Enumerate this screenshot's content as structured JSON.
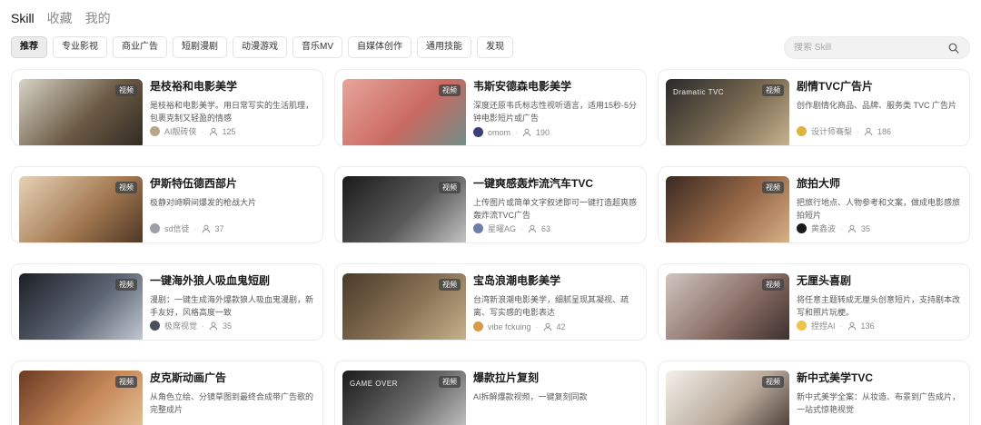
{
  "top_tabs": [
    {
      "label": "Skill",
      "active": true
    },
    {
      "label": "收藏",
      "active": false
    },
    {
      "label": "我的",
      "active": false
    }
  ],
  "filters": [
    {
      "label": "推荐",
      "active": true
    },
    {
      "label": "专业影视"
    },
    {
      "label": "商业广告"
    },
    {
      "label": "短剧漫剧"
    },
    {
      "label": "动漫游戏"
    },
    {
      "label": "音乐MV"
    },
    {
      "label": "自媒体创作"
    },
    {
      "label": "通用技能"
    },
    {
      "label": "发现"
    }
  ],
  "search": {
    "placeholder": "搜索 Skill",
    "icon": "search-icon"
  },
  "cards": [
    {
      "title": "是枝裕和电影美学",
      "desc": "是枝裕和电影美学。用日常写实的生活肌理，包裹克制又轻盈的情感",
      "author": "AI靓砖侠",
      "count": "125",
      "badge": "视频",
      "overlay": "",
      "thumb_colors": [
        "#d8d4c8",
        "#6b5a44",
        "#2f2a22"
      ],
      "avatar_color": "#b9a58a"
    },
    {
      "title": "韦斯安德森电影美学",
      "desc": "深度还原韦氏标志性视听语言，适用15秒-5分钟电影短片或广告",
      "author": "omom",
      "count": "190",
      "badge": "视频",
      "overlay": "",
      "thumb_colors": [
        "#e8a59a",
        "#c96a62",
        "#6d8f8a"
      ],
      "avatar_color": "#3a3f7a"
    },
    {
      "title": "剧情TVC广告片",
      "desc": "创作剧情化商品、品牌、服务类 TVC 广告片",
      "author": "设计师骞梨",
      "count": "186",
      "badge": "视频",
      "overlay": "Dramatic TVC",
      "thumb_colors": [
        "#2a2a2a",
        "#7a6a52",
        "#c9b58f"
      ],
      "avatar_color": "#e0b33a"
    },
    {
      "title": "伊斯特伍德西部片",
      "desc": "极静对峙瞬间爆发的枪战大片",
      "author": "sd信徒",
      "count": "37",
      "badge": "视频",
      "overlay": "",
      "thumb_colors": [
        "#e6d3b8",
        "#a47a52",
        "#4a3422"
      ],
      "avatar_color": "#9aa0a6"
    },
    {
      "title": "一键爽感轰炸流汽车TVC",
      "desc": "上传图片或简单文字叙述即可一键打造超爽感轰炸流TVC广告",
      "author": "星曜AG",
      "count": "63",
      "badge": "视频",
      "overlay": "",
      "thumb_colors": [
        "#1a1a1a",
        "#5a5a5a",
        "#c8c8c8"
      ],
      "avatar_color": "#6b7fa8"
    },
    {
      "title": "旅拍大师",
      "desc": "把旅行地点、人物参考和文案，做成电影感旅拍短片",
      "author": "黄鑫波",
      "count": "35",
      "badge": "视频",
      "overlay": "",
      "thumb_colors": [
        "#3a2a22",
        "#9a6a48",
        "#d8b48a"
      ],
      "avatar_color": "#1a1a1a"
    },
    {
      "title": "一键海外狼人吸血鬼短剧",
      "desc": "漫剧：一键生成海外爆款狼人吸血鬼漫剧，新手友好，风格高度一致",
      "author": "极席视觉",
      "count": "35",
      "badge": "视频",
      "overlay": "",
      "thumb_colors": [
        "#1c1f26",
        "#5d6675",
        "#c6ccd6"
      ],
      "avatar_color": "#4a4f5a"
    },
    {
      "title": "宝岛浪潮电影美学",
      "desc": "台湾新浪潮电影美学，细腻呈现其凝视、疏离、写实感的电影表达",
      "author": "vibe fckuing",
      "count": "42",
      "badge": "视频",
      "overlay": "",
      "thumb_colors": [
        "#4a3a2a",
        "#8a7456",
        "#c8b48e"
      ],
      "avatar_color": "#d89a4a"
    },
    {
      "title": "无厘头喜剧",
      "desc": "将任意主题转成无厘头创意短片，支持剧本改写和照片玩梗。",
      "author": "捏捏AI",
      "count": "136",
      "badge": "视频",
      "overlay": "",
      "thumb_colors": [
        "#cfc6c0",
        "#8a6e66",
        "#3a2e2a"
      ],
      "avatar_color": "#f0c24a"
    },
    {
      "title": "皮克斯动画广告",
      "desc": "从角色立绘、分镜草图到最终合成带广告歌的完整成片",
      "author": "",
      "count": "",
      "badge": "视频",
      "overlay": "",
      "thumb_colors": [
        "#6a3a22",
        "#c88a5a",
        "#e8c8a0"
      ],
      "avatar_color": "#aaaaaa"
    },
    {
      "title": "爆款拉片复刻",
      "desc": "AI拆解爆款视频，一键复刻同款",
      "author": "",
      "count": "",
      "badge": "视频",
      "overlay": "GAME OVER",
      "thumb_colors": [
        "#1a1a1a",
        "#6a6a6a",
        "#d0d0d0"
      ],
      "avatar_color": "#aaaaaa"
    },
    {
      "title": "新中式美学TVC",
      "desc": "新中式美学全案：从妆造、布景到广告成片，一站式惊艳视觉",
      "author": "",
      "count": "",
      "badge": "视频",
      "overlay": "",
      "thumb_colors": [
        "#f4f0ea",
        "#b8a89a",
        "#3a2e2a"
      ],
      "avatar_color": "#aaaaaa"
    }
  ]
}
